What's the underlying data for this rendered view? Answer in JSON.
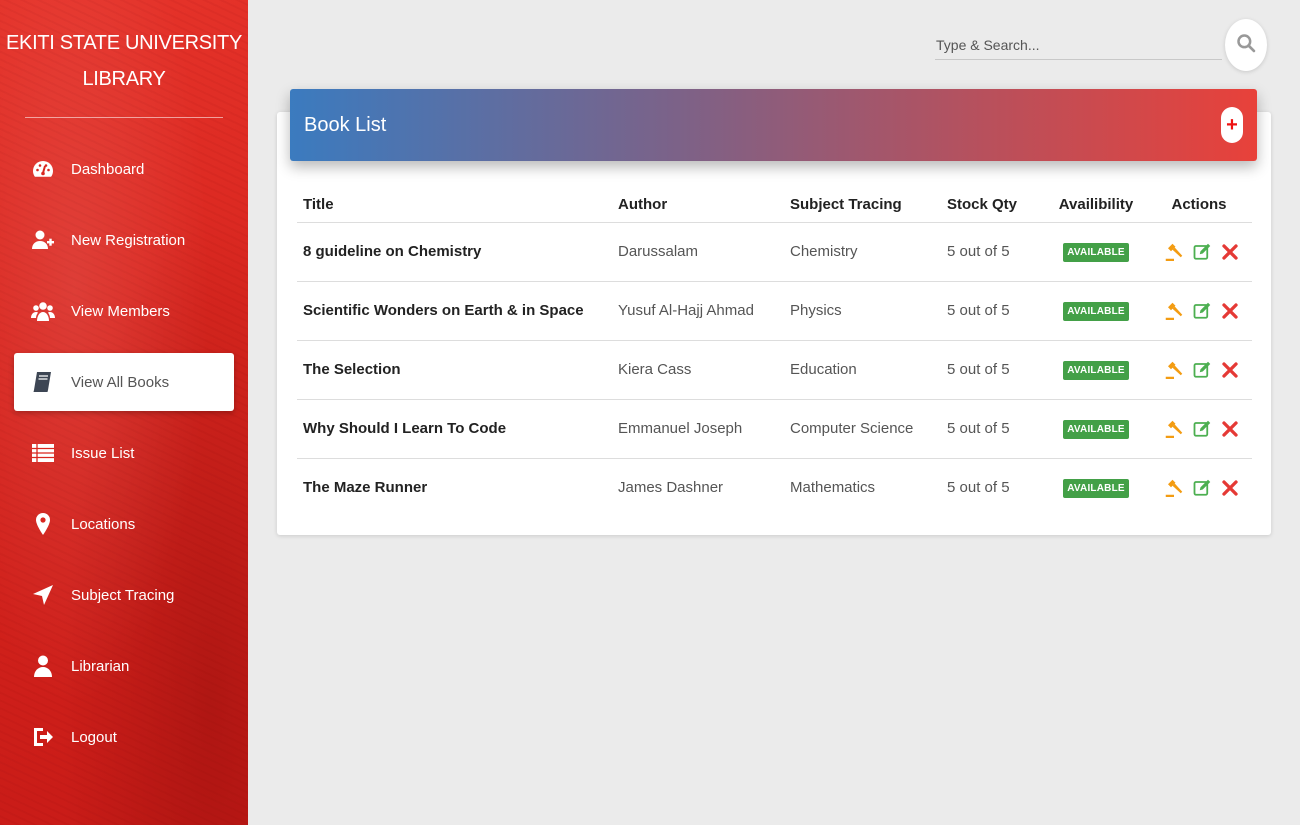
{
  "brand": {
    "line1": "EKITI STATE UNIVERSITY",
    "line2": "LIBRARY"
  },
  "sidebar": {
    "items": [
      {
        "label": "Dashboard",
        "icon": "dashboard-icon"
      },
      {
        "label": "New Registration",
        "icon": "add-user-icon"
      },
      {
        "label": "View Members",
        "icon": "members-icon"
      },
      {
        "label": "View All Books",
        "icon": "book-icon",
        "active": true
      },
      {
        "label": "Issue List",
        "icon": "list-icon"
      },
      {
        "label": "Locations",
        "icon": "location-pin-icon"
      },
      {
        "label": "Subject Tracing",
        "icon": "navigation-arrow-icon"
      },
      {
        "label": "Librarian",
        "icon": "person-icon"
      },
      {
        "label": "Logout",
        "icon": "logout-icon"
      }
    ]
  },
  "search": {
    "placeholder": "Type & Search..."
  },
  "card": {
    "title": "Book List",
    "add_label": "+"
  },
  "table": {
    "headers": [
      "Title",
      "Author",
      "Subject Tracing",
      "Stock Qty",
      "Availibility",
      "Actions"
    ],
    "rows": [
      {
        "title": "8 guideline on Chemistry",
        "author": "Darussalam",
        "subject": "Chemistry",
        "stock": "5 out of 5",
        "availability": "AVAILABLE"
      },
      {
        "title": "Scientific Wonders on Earth & in Space",
        "author": "Yusuf Al-Hajj Ahmad",
        "subject": "Physics",
        "stock": "5 out of 5",
        "availability": "AVAILABLE"
      },
      {
        "title": "The Selection",
        "author": "Kiera Cass",
        "subject": "Education",
        "stock": "5 out of 5",
        "availability": "AVAILABLE"
      },
      {
        "title": "Why Should I Learn To Code",
        "author": "Emmanuel Joseph",
        "subject": "Computer Science",
        "stock": "5 out of 5",
        "availability": "AVAILABLE"
      },
      {
        "title": "The Maze Runner",
        "author": "James Dashner",
        "subject": "Mathematics",
        "stock": "5 out of 5",
        "availability": "AVAILABLE"
      }
    ]
  },
  "colors": {
    "sidebar": "#d9261f",
    "badge": "#43a047",
    "issue_icon": "#f39c12",
    "edit_icon": "#4caf50",
    "delete_icon": "#e53935"
  }
}
